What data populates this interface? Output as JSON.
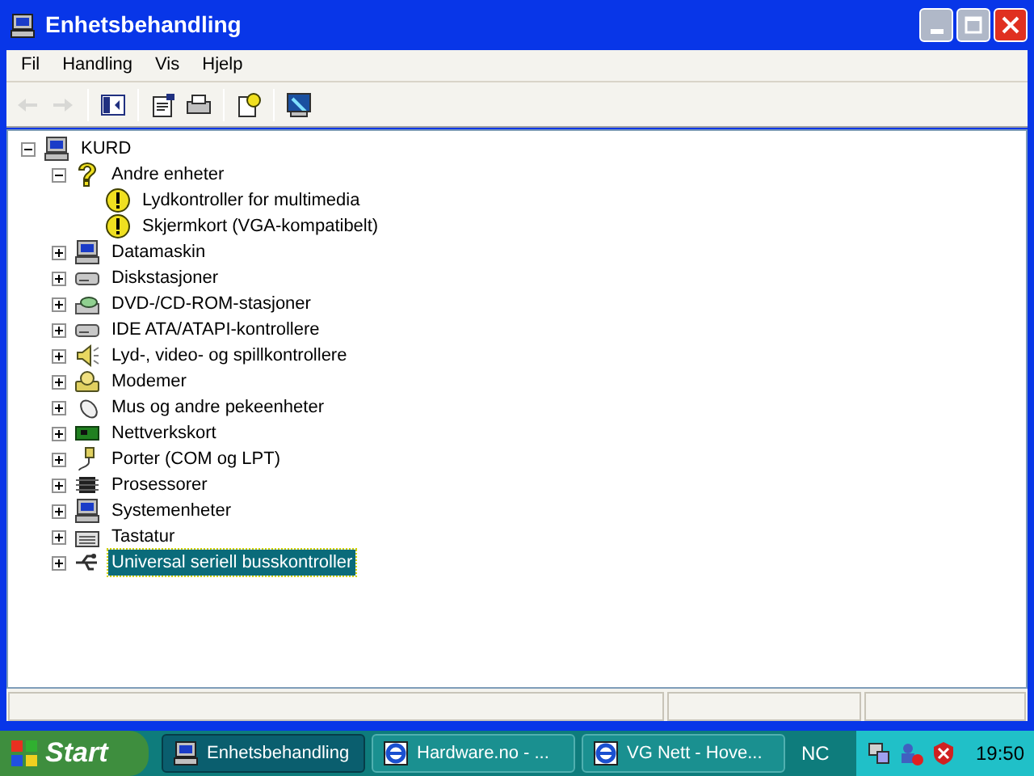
{
  "window": {
    "title": "Enhetsbehandling"
  },
  "menu": [
    "Fil",
    "Handling",
    "Vis",
    "Hjelp"
  ],
  "toolbar": [
    {
      "kind": "back",
      "disabled": true
    },
    {
      "kind": "forward",
      "disabled": true
    },
    {
      "kind": "separator"
    },
    {
      "kind": "tree",
      "disabled": false
    },
    {
      "kind": "separator"
    },
    {
      "kind": "properties",
      "disabled": false
    },
    {
      "kind": "print",
      "disabled": false
    },
    {
      "kind": "separator"
    },
    {
      "kind": "help",
      "disabled": false
    },
    {
      "kind": "separator"
    },
    {
      "kind": "scan",
      "disabled": false
    }
  ],
  "tree": {
    "label": "KURD",
    "kind": "computer",
    "expanded": true,
    "selected": false,
    "children": [
      {
        "label": "Andre enheter",
        "kind": "unknown",
        "expanded": true,
        "selected": false,
        "children": [
          {
            "label": "Lydkontroller for multimedia",
            "kind": "problem",
            "selected": false
          },
          {
            "label": "Skjermkort (VGA-kompatibelt)",
            "kind": "problem",
            "selected": false
          }
        ]
      },
      {
        "label": "Datamaskin",
        "kind": "computer",
        "expanded": false,
        "selected": false
      },
      {
        "label": "Diskstasjoner",
        "kind": "disk",
        "expanded": false,
        "selected": false
      },
      {
        "label": "DVD-/CD-ROM-stasjoner",
        "kind": "cdrom",
        "expanded": false,
        "selected": false
      },
      {
        "label": "IDE ATA/ATAPI-kontrollere",
        "kind": "disk",
        "expanded": false,
        "selected": false
      },
      {
        "label": "Lyd-, video- og spillkontrollere",
        "kind": "sound",
        "expanded": false,
        "selected": false
      },
      {
        "label": "Modemer",
        "kind": "modem",
        "expanded": false,
        "selected": false
      },
      {
        "label": "Mus og andre pekeenheter",
        "kind": "mouse",
        "expanded": false,
        "selected": false
      },
      {
        "label": "Nettverkskort",
        "kind": "network",
        "expanded": false,
        "selected": false
      },
      {
        "label": "Porter (COM og LPT)",
        "kind": "port",
        "expanded": false,
        "selected": false
      },
      {
        "label": "Prosessorer",
        "kind": "chip",
        "expanded": false,
        "selected": false
      },
      {
        "label": "Systemenheter",
        "kind": "computer",
        "expanded": false,
        "selected": false
      },
      {
        "label": "Tastatur",
        "kind": "keyboard",
        "expanded": false,
        "selected": false
      },
      {
        "label": "Universal seriell busskontroller",
        "kind": "usb",
        "expanded": false,
        "selected": true
      }
    ]
  },
  "taskbar": {
    "start": "Start",
    "tasks": [
      {
        "label": "Enhetsbehandling",
        "kind": "computer",
        "selected": true
      },
      {
        "label": "Hardware.no - ...",
        "kind": "browser",
        "selected": false
      },
      {
        "label": "VG Nett - Hove...",
        "kind": "browser",
        "selected": false
      }
    ],
    "indicator": "NC",
    "clock": "19:50"
  }
}
